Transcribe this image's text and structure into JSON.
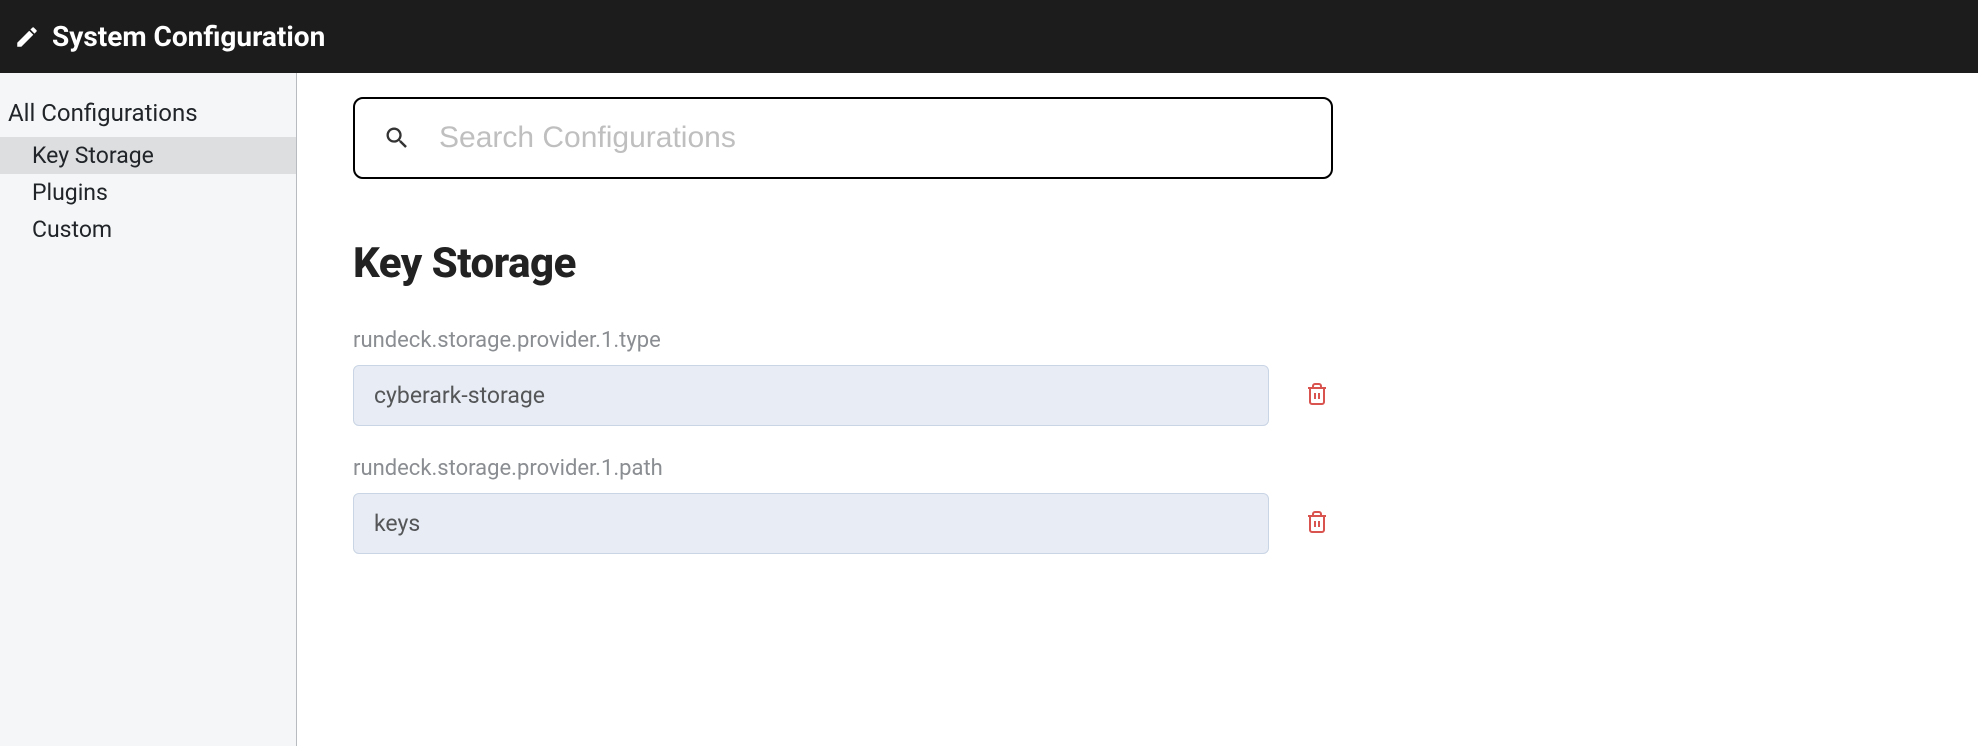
{
  "header": {
    "title": "System Configuration"
  },
  "sidebar": {
    "heading": "All Configurations",
    "items": [
      {
        "label": "Key Storage",
        "active": true
      },
      {
        "label": "Plugins",
        "active": false
      },
      {
        "label": "Custom",
        "active": false
      }
    ]
  },
  "search": {
    "placeholder": "Search Configurations"
  },
  "section": {
    "title": "Key Storage"
  },
  "configs": [
    {
      "label": "rundeck.storage.provider.1.type",
      "value": "cyberark-storage"
    },
    {
      "label": "rundeck.storage.provider.1.path",
      "value": "keys"
    }
  ]
}
